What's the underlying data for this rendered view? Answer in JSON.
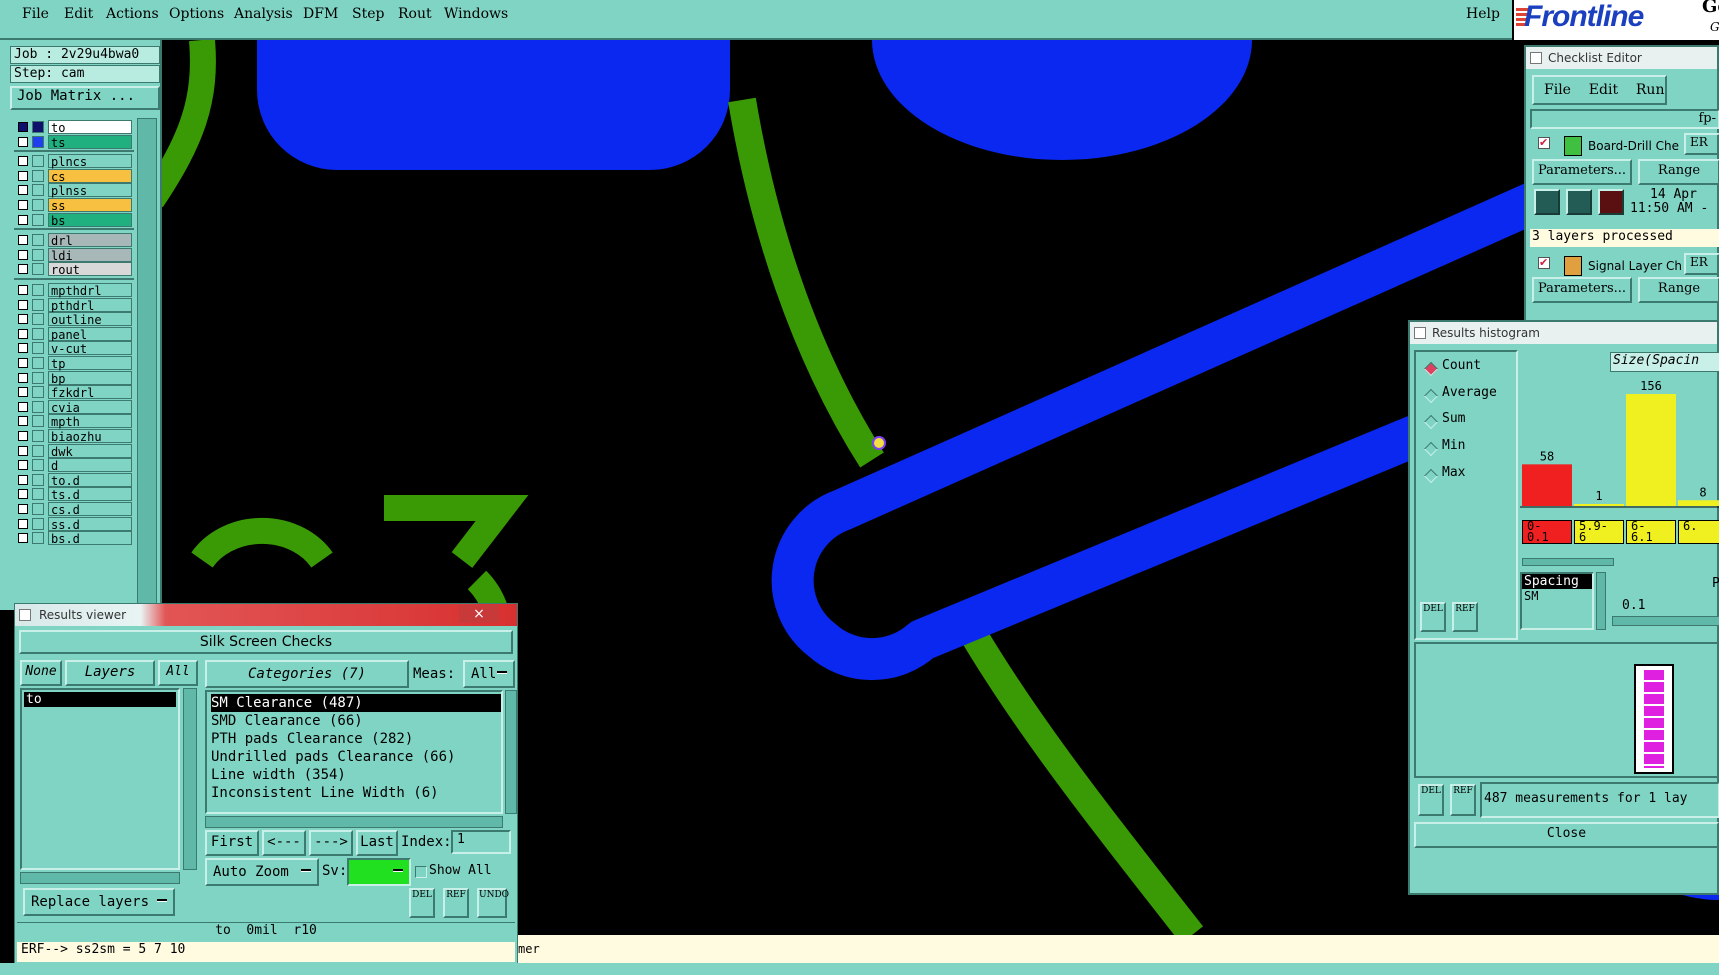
{
  "menu": {
    "items": [
      "File",
      "Edit",
      "Actions",
      "Options",
      "Analysis",
      "DFM",
      "Step",
      "Rout",
      "Windows"
    ],
    "help": "Help"
  },
  "logo": {
    "text": "Frontline",
    "suffix": "Ge",
    "suffix2": "G"
  },
  "job": {
    "job_line": "Job : 2v29u4bwa0",
    "step_line": "Step: cam",
    "matrix_button": "Job Matrix ..."
  },
  "layers": [
    {
      "name": "to",
      "color": "#ffffff",
      "selected": true
    },
    {
      "name": "ts",
      "color": "#20b080"
    },
    {
      "name": "plncs",
      "color": "#80d4c4"
    },
    {
      "name": "cs",
      "color": "#f8c040"
    },
    {
      "name": "plnss",
      "color": "#80d4c4"
    },
    {
      "name": "ss",
      "color": "#f8c040"
    },
    {
      "name": "bs",
      "color": "#20b080"
    },
    {
      "name": "drl",
      "color": "#a8b8b8"
    },
    {
      "name": "ldi",
      "color": "#a8b8b8"
    },
    {
      "name": "rout",
      "color": "#d8d8d8"
    },
    {
      "name": "mpthdrl",
      "color": "#80d4c4"
    },
    {
      "name": "pthdrl",
      "color": "#80d4c4"
    },
    {
      "name": "outline",
      "color": "#80d4c4"
    },
    {
      "name": "panel",
      "color": "#80d4c4"
    },
    {
      "name": "v-cut",
      "color": "#80d4c4"
    },
    {
      "name": "tp",
      "color": "#80d4c4"
    },
    {
      "name": "bp",
      "color": "#80d4c4"
    },
    {
      "name": "fzkdrl",
      "color": "#80d4c4"
    },
    {
      "name": "cvia",
      "color": "#80d4c4"
    },
    {
      "name": "mpth",
      "color": "#80d4c4"
    },
    {
      "name": "biaozhu",
      "color": "#80d4c4"
    },
    {
      "name": "dwk",
      "color": "#80d4c4"
    },
    {
      "name": "d",
      "color": "#80d4c4"
    },
    {
      "name": "to.d",
      "color": "#80d4c4"
    },
    {
      "name": "ts.d",
      "color": "#80d4c4"
    },
    {
      "name": "cs.d",
      "color": "#80d4c4"
    },
    {
      "name": "ss.d",
      "color": "#80d4c4"
    },
    {
      "name": "bs.d",
      "color": "#80d4c4"
    }
  ],
  "results_viewer": {
    "title": "Results viewer",
    "close": "×",
    "heading": "Silk Screen Checks",
    "none_btn": "None",
    "layers_btn": "Layers",
    "all_btn": "All",
    "categories_btn": "Categories (7)",
    "meas_label": "Meas:",
    "meas_value": "All",
    "layer_selected": "to",
    "categories": [
      "SM Clearance (487)",
      "SMD Clearance (66)",
      "PTH pads Clearance (282)",
      "Undrilled pads Clearance (66)",
      "Line width (354)",
      "Inconsistent Line Width (6)"
    ],
    "first": "First",
    "prev": "<---",
    "next": "--->",
    "last": "Last",
    "index_label": "Index:",
    "index_value": "1",
    "autozoom": "Auto Zoom",
    "sv_label": "Sv:",
    "show_all": "Show All",
    "replace": "Replace layers",
    "del": "DEL",
    "ref": "REF",
    "undo": "UNDO",
    "info": "to  0mil  r10",
    "erf": "ERF--> ss2sm = 5 7 10"
  },
  "checklist_editor": {
    "title": "Checklist Editor",
    "menu": [
      "File",
      "Edit",
      "Run"
    ],
    "fp": "fp-",
    "check1": "Board-Drill Che",
    "er": "ER",
    "params": "Parameters...",
    "range": "Range",
    "date1": "14 Apr",
    "time1": "11:50 AM -",
    "processed": "3 layers processed",
    "check2": "Signal Layer Ch"
  },
  "histogram": {
    "title": "Results histogram",
    "modes": [
      "Count",
      "Average",
      "Sum",
      "Min",
      "Max"
    ],
    "selected_mode": "Count",
    "axis_title": "Size(Spacin",
    "bars": [
      {
        "label": "0-\n0.1",
        "value": 58,
        "color": "#f02020"
      },
      {
        "label": "5.9-\n6",
        "value": 1,
        "color": "#f0f020"
      },
      {
        "label": "6-\n6.1",
        "value": 156,
        "color": "#f0f020"
      },
      {
        "label": "6.",
        "value": 8,
        "color": "#f0f020"
      }
    ],
    "spacing_label": "Spacing",
    "sm_label": "SM",
    "range_value": "0.1",
    "range_p": "P",
    "del": "DEL",
    "ref": "REF",
    "measurements": "487 measurements for 1 lay",
    "close": "Close"
  },
  "status": {
    "text": "mer"
  },
  "colors": {
    "teal": "#80d4c4",
    "blue": "#0a28f0",
    "green": "#3a9a06"
  }
}
